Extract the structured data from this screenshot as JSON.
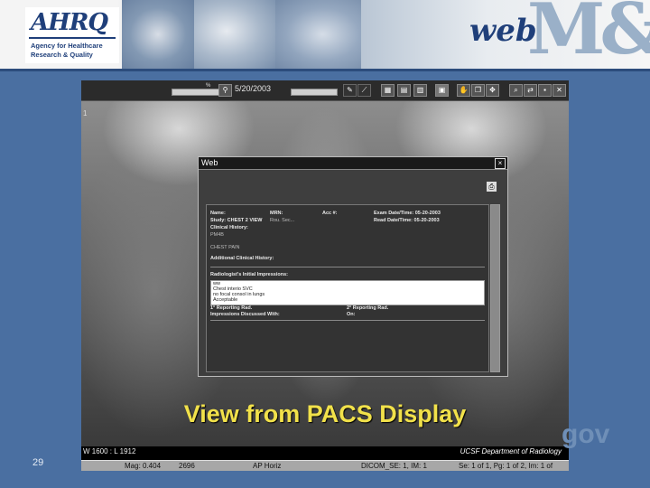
{
  "header": {
    "logo_mark": "AHRQ",
    "logo_line1": "Agency for Healthcare",
    "logo_line2": "Research & Quality",
    "brand_web": "web",
    "brand_mm": "M&M"
  },
  "toolbar": {
    "study_date": "5/20/2003",
    "slider_number": "%"
  },
  "viewer": {
    "image_index": "1",
    "window_level": "W 1600 : L 1912",
    "department": "UCSF Department of Radiology",
    "status": {
      "mag": "Mag: 0.404",
      "code": "2696",
      "orientation": "AP Horiz",
      "series": "DICOM_SE: 1, IM: 1",
      "position": "Se: 1 of 1,  Pg: 1 of 2,  Im: 1 of"
    }
  },
  "dialog": {
    "title": "Web",
    "close": "×",
    "fields": {
      "name_label": "Name:",
      "mrn_label": "MRN:",
      "acc_label": "Acc #:",
      "exam_date_label": "Exam Date/Time: 05-20-2003",
      "study_label": "Study: CHEST 2 VIEW",
      "study_desc": "Rou. Sec...",
      "read_date_label": "Read Date/Time: 05-20-2003",
      "clinical_history_label": "Clinical History:",
      "clinical_history_value": "PM4B",
      "chest_pain": "CHEST PAIN",
      "additional_history_label": "Additional Clinical History:",
      "impressions_label": "Radiologist's Initial Impressions:",
      "impressions_lines": [
        "ww",
        "Chest interio SVC",
        "no focal consol in lungs",
        "Acceptable"
      ],
      "reporting_1": "1° Reporting Rad.",
      "reporting_2": "2° Reporting Rad.",
      "discussed_label": "Impressions Discussed With:",
      "on_label": "On:"
    }
  },
  "caption": "View from PACS Display",
  "watermark": "gov",
  "slide_number": "29"
}
